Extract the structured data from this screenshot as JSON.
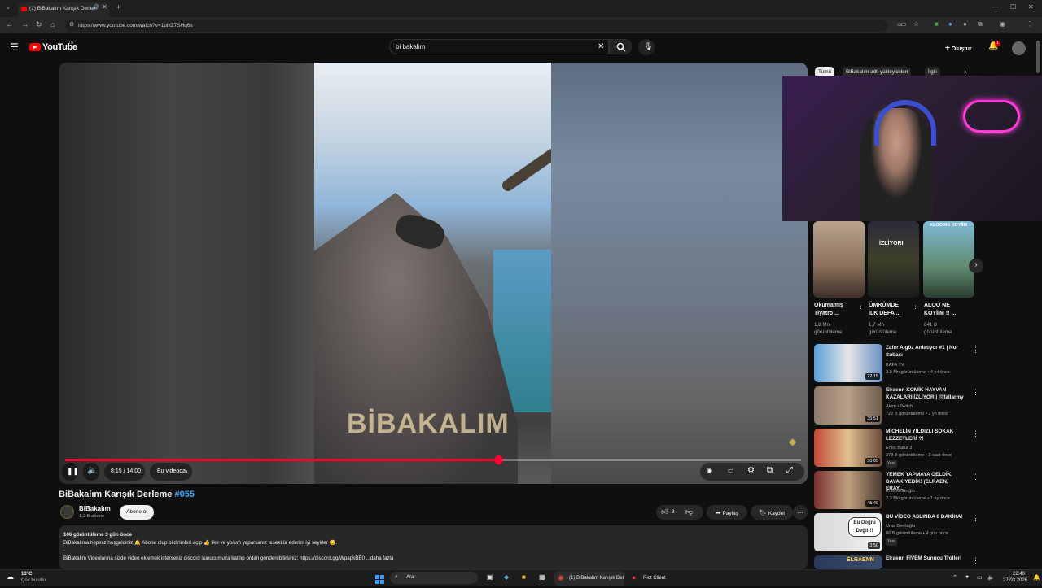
{
  "browser": {
    "tab_title": "(1) BiBakalım Karışık Derle",
    "url": "https://www.youtube.com/watch?v=1ulxZ7SHq6s"
  },
  "header": {
    "logo_text": "YouTube",
    "region": "TR",
    "search_value": "bi bakalım",
    "create_label": "Oluştur",
    "notification_count": "1"
  },
  "player": {
    "watermark": "BİBAKALIM",
    "time": "8:15 / 14:00",
    "in_video_label": "Bu videoda",
    "progress": 0.589
  },
  "video": {
    "title": "BiBakalım Karışık Derleme",
    "title_tag": "#055",
    "channel": "BiBakalım",
    "subscribers": "1,2 B abone",
    "subscribe_label": "Abone ol",
    "likes": "3",
    "share_label": "Paylaş",
    "save_label": "Kaydet"
  },
  "description": {
    "stats": "106 görüntüleme  3 gün önce",
    "line1": "BiBakalıma hepiniz hoşgeldiniz  🔔 Abone olup bildirimleri açıp 👍 like ve yorum yaparsanız teşekkür ederim iyi seyirler 😊.",
    "line2": ".",
    "line3": "BiBakalım Videolarına sizde video eklemek isterseniz discord sunucumuza katılıp ordan gönderebilirsiniz: https://discord.gg/WpapkBB0  ...daha fazla"
  },
  "sidebar": {
    "chips": [
      "Tümü",
      "BiBakalım adlı yükleyiciden",
      "İlgili"
    ],
    "shorts": [
      {
        "title1": "Okumamış",
        "title2": "Tiyatro ...",
        "views1": "1,8 Mn",
        "views2": "görüntüleme",
        "overlay": ""
      },
      {
        "title1": "ÖMRÜMDE",
        "title2": "İLK DEFA ...",
        "views1": "1,7 Mn",
        "views2": "görüntüleme",
        "overlay": "İZLİYORI"
      },
      {
        "title1": "ALOO NE",
        "title2": "KOYİİM !! ...",
        "views1": "841 B",
        "views2": "görüntüleme",
        "overlay": "ALOO NE KOYİİM"
      }
    ],
    "recommendations": [
      {
        "title": "Zafer Algöz Anlatıyor #1 | Nur Subaşı",
        "channel": "KAFA TV",
        "meta": "3,9 Mn görüntüleme • 4 yıl önce",
        "duration": "22:15",
        "new": ""
      },
      {
        "title": "Elraenn KOMİK HAYVAN KAZALARI İZLİYOR | @fallarmy",
        "channel": "Alem-i Twitch",
        "meta": "722 B görüntüleme • 1 yıl önce",
        "duration": "35:51",
        "new": ""
      },
      {
        "title": "MİCHELİN YILDIZLI SOKAK LEZZETLERİ ?!",
        "channel": "Enes Batur 3",
        "meta": "378 B görüntüleme • 2 saat önce",
        "duration": "30:05",
        "new": "Yeni"
      },
      {
        "title": "YEMEK YAPMAYA GELDİK, DAYAK YEDİK! (ELRAEN, ERAY,...",
        "channel": "Enis Kirazoğlu",
        "meta": "2,3 Mn görüntüleme • 1 ay önce",
        "duration": "45:40",
        "new": ""
      },
      {
        "title": "BU VİDEO ASLINDA 6 DAKİKA!",
        "channel": "Uras Benlioğlu",
        "meta": "66 B görüntüleme • 4 gün önce",
        "duration": "3:50",
        "new": "Yeni",
        "thumb_text1": "Bu Doğru",
        "thumb_text2": "Değil!!!"
      },
      {
        "title": "Elraenn FİVEM Sunucu Trolleri",
        "channel": "",
        "meta": "",
        "duration": "",
        "new": "",
        "thumb_text1": "ELRAENN"
      }
    ]
  },
  "taskbar": {
    "weather_temp": "13°C",
    "weather_desc": "Çok bulutlu",
    "search_label": "Ara",
    "chrome_label": "(1) BiBakalım Karışık Der",
    "riot_label": "Riot Client",
    "time": "22:40",
    "date": "27.03.2026"
  },
  "colors": {
    "youtube_red": "#ff0000",
    "progress_red": "#ff0033",
    "link_blue": "#3ea6ff",
    "background": "#0f0f0f"
  }
}
